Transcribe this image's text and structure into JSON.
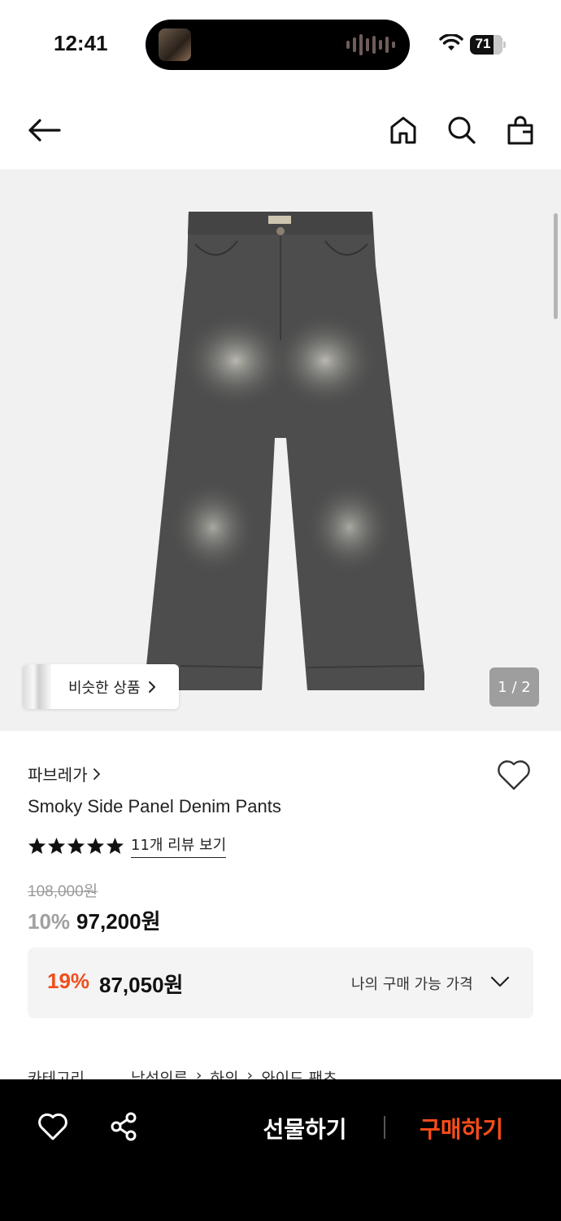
{
  "status_bar": {
    "time": "12:41",
    "battery": "71"
  },
  "nav": {
    "back_icon": "arrow-left-icon",
    "home_icon": "home-icon",
    "search_icon": "search-icon",
    "bag_icon": "shopping-bag-icon"
  },
  "gallery": {
    "similar_label": "비슷한 상품",
    "page_indicator": "1 / 2"
  },
  "product": {
    "brand": "파브레가",
    "name": "Smoky Side Panel Denim Pants",
    "rating_stars": 5,
    "review_link": "11개 리뷰 보기",
    "original_price": "108,000원",
    "discount_rate": "10%",
    "sale_price": "97,200원"
  },
  "my_price": {
    "discount": "19%",
    "price": "87,050원",
    "label": "나의 구매 가능 가격"
  },
  "category": {
    "label": "카테고리",
    "path": [
      "남성의류",
      "하의",
      "와이드 팬츠"
    ]
  },
  "bottom_bar": {
    "gift_label": "선물하기",
    "buy_label": "구매하기"
  },
  "colors": {
    "accent": "#f04e1c",
    "bottom_bar_bg": "#000000"
  }
}
